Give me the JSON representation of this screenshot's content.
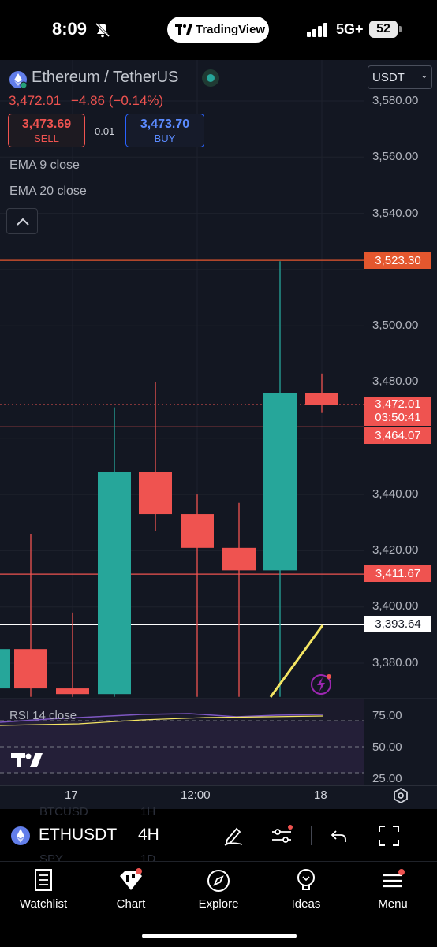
{
  "status_bar": {
    "time": "8:09",
    "app_pill": "TradingView",
    "network": "5G+",
    "battery": "52"
  },
  "header": {
    "title": "Ethereum / TetherUS",
    "last_price": "3,472.01",
    "change": "−4.86 (−0.14%)",
    "sell": {
      "price": "3,473.69",
      "label": "SELL"
    },
    "spread": "0.01",
    "buy": {
      "price": "3,473.70",
      "label": "BUY"
    },
    "indicators": [
      "EMA 9 close",
      "EMA 20 close"
    ],
    "currency": "USDT"
  },
  "price_scale": {
    "ticks": [
      "3,580.00",
      "3,560.00",
      "3,540.00",
      "3,500.00",
      "3,480.00",
      "3,440.00",
      "3,420.00",
      "3,400.00",
      "3,380.00"
    ],
    "labels": {
      "alert": "3,523.30",
      "last": "3,472.01",
      "countdown": "03:50:41",
      "level_high": "3,464.07",
      "level_low": "3,411.67",
      "cursor": "3,393.64"
    }
  },
  "chart_data": {
    "type": "candlestick",
    "candles": [
      {
        "o": 3385,
        "h": 3392,
        "l": 3368,
        "c": 3371,
        "dir": "up"
      },
      {
        "o": 3385,
        "h": 3426,
        "l": 3368,
        "c": 3371,
        "dir": "down"
      },
      {
        "o": 3371,
        "h": 3398,
        "l": 3368,
        "c": 3369,
        "dir": "down"
      },
      {
        "o": 3369,
        "h": 3471,
        "l": 3368,
        "c": 3448,
        "dir": "up"
      },
      {
        "o": 3448,
        "h": 3480,
        "l": 3427,
        "c": 3433,
        "dir": "down"
      },
      {
        "o": 3433,
        "h": 3440,
        "l": 3368,
        "c": 3421,
        "dir": "down"
      },
      {
        "o": 3421,
        "h": 3437,
        "l": 3368,
        "c": 3413,
        "dir": "down"
      },
      {
        "o": 3413,
        "h": 3523,
        "l": 3368,
        "c": 3476,
        "dir": "up"
      },
      {
        "o": 3476,
        "h": 3483,
        "l": 3469,
        "c": 3472,
        "dir": "down"
      }
    ],
    "ylim": [
      3368,
      3590
    ],
    "horizontal_lines": [
      3523.3,
      3472.01,
      3464.07,
      3411.67,
      3393.64
    ],
    "rsi": {
      "title": "RSI 14 close",
      "ticks": [
        "75.00",
        "50.00",
        "25.00"
      ]
    },
    "x_ticks": [
      "17",
      "12:00",
      "18"
    ]
  },
  "toolbar": {
    "ghost_symbols": [
      "BTCUSD",
      "1H",
      "SPY",
      "1D"
    ],
    "symbol": "ETHUSDT",
    "interval": "4H"
  },
  "bottom_nav": {
    "items": [
      {
        "label": "Watchlist",
        "icon": "watchlist-icon"
      },
      {
        "label": "Chart",
        "icon": "chart-icon"
      },
      {
        "label": "Explore",
        "icon": "compass-icon"
      },
      {
        "label": "Ideas",
        "icon": "lightbulb-icon"
      },
      {
        "label": "Menu",
        "icon": "menu-icon"
      }
    ]
  },
  "colors": {
    "up": "#26a69a",
    "down": "#ef5350",
    "alert": "#e4572e",
    "background": "#131722"
  }
}
